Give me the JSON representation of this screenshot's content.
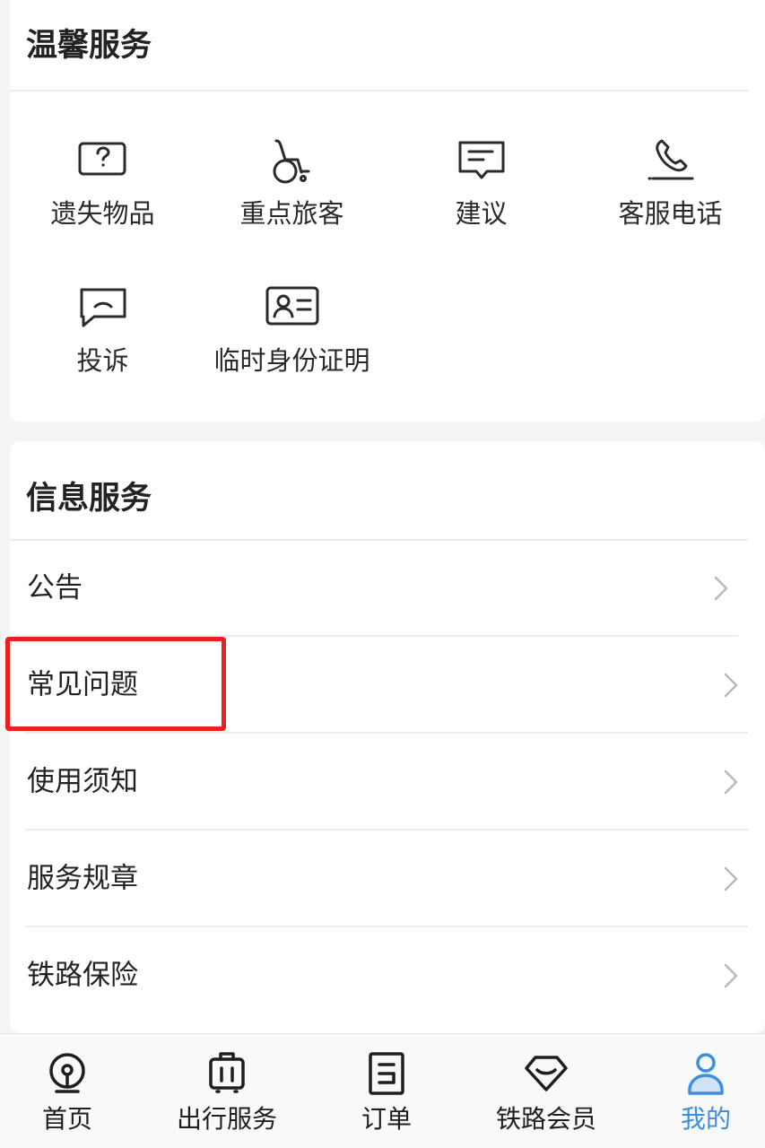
{
  "warm_service": {
    "title": "温馨服务",
    "items": [
      {
        "label": "遗失物品",
        "icon": "question-box-icon"
      },
      {
        "label": "重点旅客",
        "icon": "wheelchair-icon"
      },
      {
        "label": "建议",
        "icon": "suggestion-chat-icon"
      },
      {
        "label": "客服电话",
        "icon": "phone-icon"
      },
      {
        "label": "投诉",
        "icon": "complaint-chat-icon"
      },
      {
        "label": "临时身份证明",
        "icon": "id-card-icon"
      }
    ]
  },
  "info_service": {
    "title": "信息服务",
    "rows": [
      {
        "label": "公告"
      },
      {
        "label": "常见问题"
      },
      {
        "label": "使用须知"
      },
      {
        "label": "服务规章"
      },
      {
        "label": "铁路保险"
      }
    ]
  },
  "highlight": {
    "color": "#e8211f",
    "target": "常见问题"
  },
  "tab_bar": {
    "active_color": "#3c8fe0",
    "tabs": [
      {
        "label": "首页",
        "icon": "railway-logo-icon",
        "active": false
      },
      {
        "label": "出行服务",
        "icon": "luggage-icon",
        "active": false
      },
      {
        "label": "订单",
        "icon": "order-doc-icon",
        "active": false
      },
      {
        "label": "铁路会员",
        "icon": "diamond-icon",
        "active": false
      },
      {
        "label": "我的",
        "icon": "user-icon",
        "active": true
      }
    ]
  }
}
